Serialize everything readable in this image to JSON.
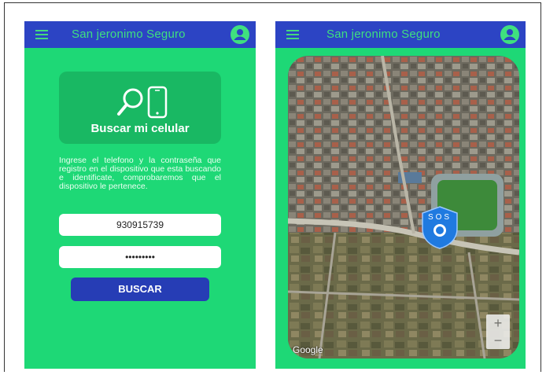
{
  "left_screen": {
    "app_title": "San jeronimo Seguro",
    "menu_icon": "hamburger-menu-icon",
    "account_icon": "account-circle-icon",
    "card": {
      "title": "Buscar mi celular",
      "icons": [
        "search-icon",
        "phone-icon"
      ]
    },
    "description": "Ingrese el telefono y la contraseña que registro en el dispositivo que esta buscando e identificate, comprobaremos que el dispositivo le pertenece.",
    "phone_value": "930915739",
    "password_value": "•••••••••",
    "search_button": "BUSCAR"
  },
  "right_screen": {
    "app_title": "San jeronimo Seguro",
    "menu_icon": "hamburger-menu-icon",
    "account_icon": "account-circle-icon",
    "map": {
      "marker_label": "SOS",
      "attribution": "Google",
      "zoom_in": "+",
      "zoom_out": "−"
    }
  },
  "colors": {
    "screen_bg": "#1ed876",
    "appbar": "#2c44c4",
    "title_text": "#3fe07f",
    "button": "#263db5",
    "marker": "#1f7ae0"
  }
}
